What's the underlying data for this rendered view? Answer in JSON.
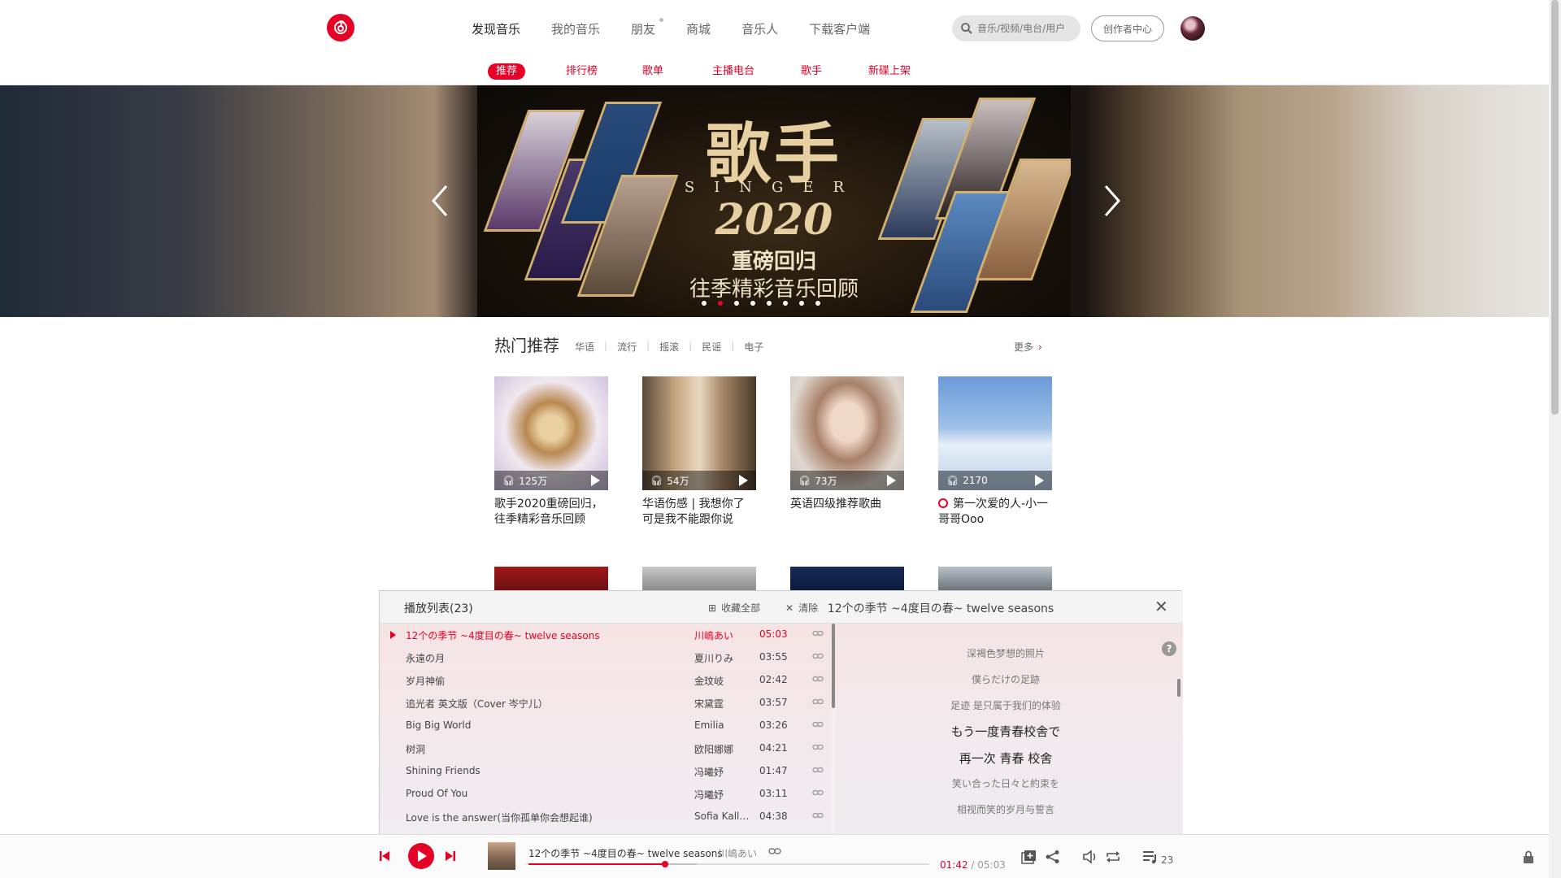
{
  "nav": {
    "items": [
      "发现音乐",
      "我的音乐",
      "朋友",
      "商城",
      "音乐人",
      "下载客户端"
    ],
    "search_placeholder": "音乐/视频/电台/用户",
    "creator_label": "创作者中心"
  },
  "subnav": {
    "items": [
      "推荐",
      "排行榜",
      "歌单",
      "主播电台",
      "歌手",
      "新碟上架"
    ]
  },
  "banner": {
    "title_cn": "歌手",
    "title_en": "SINGER",
    "year": "2020",
    "sub1": "重磅回归",
    "sub2": "往季精彩音乐回顾",
    "dots_total": 8,
    "dot_active": 1
  },
  "hot": {
    "title": "热门推荐",
    "tags": [
      "华语",
      "流行",
      "摇滚",
      "民谣",
      "电子"
    ],
    "more": "更多",
    "cards": [
      {
        "count": "125万",
        "title": "歌手2020重磅回归，往季精彩音乐回顾"
      },
      {
        "count": "54万",
        "title": "华语伤感 | 我想你了 可是我不能跟你说"
      },
      {
        "count": "73万",
        "title": "英语四级推荐歌曲"
      },
      {
        "count": "2170",
        "title": "第一次爱的人-小一哥哥Ooo"
      }
    ]
  },
  "playlist": {
    "title": "播放列表(23)",
    "collect_all": "收藏全部",
    "clear": "清除",
    "current_song": "12个の季节 ~4度目の春~ twelve seasons",
    "rows": [
      {
        "title": "12个の季节 ~4度目の春~ twelve seasons",
        "artist": "川嶋あい",
        "duration": "05:03"
      },
      {
        "title": "永遠の月",
        "artist": "夏川りみ",
        "duration": "03:55"
      },
      {
        "title": "岁月神偷",
        "artist": "金玟岐",
        "duration": "02:42"
      },
      {
        "title": "追光者 英文版（Cover 岑宁儿）",
        "artist": "宋黛霆",
        "duration": "03:57"
      },
      {
        "title": "Big Big World",
        "artist": "Emilia",
        "duration": "03:26"
      },
      {
        "title": "树洞",
        "artist": "欧阳娜娜",
        "duration": "04:21"
      },
      {
        "title": "Shining Friends",
        "artist": "冯曦妤",
        "duration": "01:47"
      },
      {
        "title": "Proud Of You",
        "artist": "冯曦妤",
        "duration": "03:11"
      },
      {
        "title": "Love is the answer(当你孤单你会想起谁)",
        "artist": "Sofia Kall…",
        "duration": "04:38"
      }
    ],
    "lyrics": [
      "深褐色梦想的照片",
      "僕らだけの足跡",
      "足迹 是只属于我们的体验",
      "もう一度青春校舎で",
      "再一次 青春 校舍",
      "笑い合った日々と約束を",
      "相视而笑的岁月与誓言"
    ],
    "help": "?"
  },
  "player": {
    "title": "12个の季节 ~4度目の春~ twelve seasons",
    "artist": "川嶋あい",
    "current_time": "01:42",
    "total_time": "/ 05:03",
    "progress": 0.34,
    "buffered": 0.42,
    "playlist_count": "23"
  },
  "colors": {
    "accent": "#e60026"
  }
}
